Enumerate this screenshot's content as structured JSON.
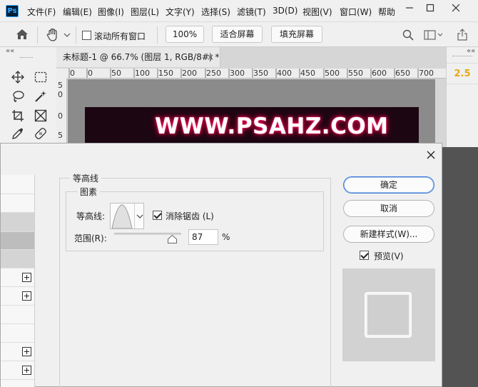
{
  "app": {
    "logo": "Ps"
  },
  "menu": [
    "文件(F)",
    "编辑(E)",
    "图像(I)",
    "图层(L)",
    "文字(Y)",
    "选择(S)",
    "滤镜(T)",
    "3D(D)",
    "视图(V)",
    "窗口(W)",
    "帮助"
  ],
  "options_bar": {
    "scroll_all_label": "滚动所有窗口",
    "zoom_value": "100%",
    "fit_screen": "适合屏幕",
    "fill_screen": "填充屏幕"
  },
  "document": {
    "tab_title": "未标题-1 @ 66.7% (图层 1, RGB/8#) *",
    "close_glyph": "×",
    "ruler_h_ticks": [
      "0",
      "0",
      "50",
      "100",
      "150",
      "200",
      "250",
      "300",
      "350",
      "400",
      "450",
      "500",
      "550",
      "600",
      "650",
      "700"
    ],
    "ruler_v_ticks": [
      "5",
      "0",
      "0",
      "5"
    ],
    "canvas_text": "WWW.PSAHZ.COM",
    "canvas_text_color": "#ffffff",
    "glow_color": "#e8004d"
  },
  "right_panel": {
    "value": "2.5",
    "value_color": "#e6a817"
  },
  "collapse_glyph": "««",
  "dialog": {
    "close_glyph": "×",
    "section_title": "等高线",
    "group_title": "图素",
    "contour_label": "等高线:",
    "antialias_label": "消除锯齿 (L)",
    "antialias_checked": true,
    "range_label": "范围(R):",
    "range_value": "87",
    "range_percent": 87,
    "range_unit": "%",
    "buttons": {
      "ok": "确定",
      "cancel": "取消",
      "new_style": "新建样式(W)..."
    },
    "preview_label": "预览(V)",
    "preview_checked": true
  }
}
